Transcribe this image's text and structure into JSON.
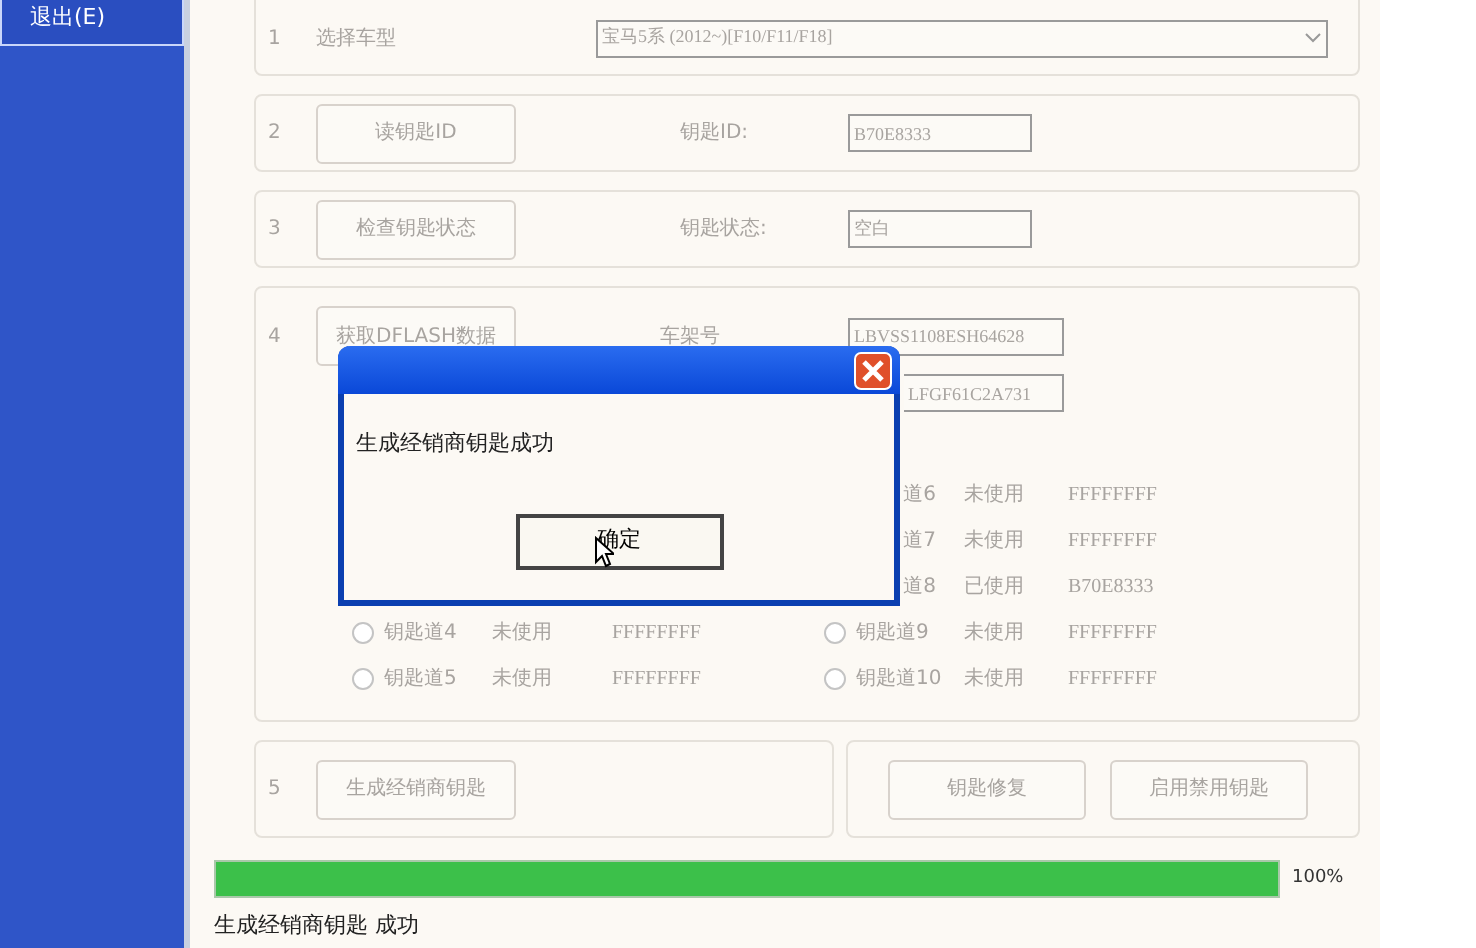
{
  "sidebar": {
    "items": [
      {
        "label": "退出(E)",
        "selected": true
      }
    ]
  },
  "steps": [
    {
      "kind": "select",
      "number": "1",
      "label": "选择车型",
      "value": "宝马5系 (2012~)[F10/F11/F18]"
    },
    {
      "kind": "read",
      "number": "2",
      "button": "读钥匙ID",
      "label": "钥匙ID:",
      "value": "B70E8333"
    },
    {
      "kind": "read",
      "number": "3",
      "button": "检查钥匙状态",
      "label": "钥匙状态:",
      "value": "空白"
    },
    {
      "kind": "keys",
      "number": "4",
      "button": "获取DFLASH数据",
      "label": "车架号",
      "value": "LBVSS1108ESH64628",
      "value_2": "LFGF61C2A731",
      "key_rows": [
        {
          "right": {
            "kind": "partial",
            "label": "道6",
            "status": "未使用",
            "code": "FFFFFFFF"
          }
        },
        {
          "right": {
            "kind": "partial",
            "label": "道7",
            "status": "未使用",
            "code": "FFFFFFFF"
          }
        },
        {
          "right": {
            "kind": "partial",
            "label": "道8",
            "status": "已使用",
            "code": "B70E8333"
          }
        },
        {
          "left": {
            "kind": "full",
            "selected": false,
            "label": "钥匙道4",
            "status": "未使用",
            "code": "FFFFFFFF"
          },
          "right": {
            "kind": "full",
            "selected": false,
            "label": "钥匙道9",
            "status": "未使用",
            "code": "FFFFFFFF"
          }
        },
        {
          "left": {
            "kind": "full",
            "selected": false,
            "label": "钥匙道5",
            "status": "未使用",
            "code": "FFFFFFFF"
          },
          "right": {
            "kind": "full",
            "selected": false,
            "label": "钥匙道10",
            "status": "未使用",
            "code": "FFFFFFFF"
          }
        }
      ]
    },
    {
      "kind": "actions",
      "number": "5",
      "button": "生成经销商钥匙",
      "buttons": [
        "钥匙修复",
        "启用禁用钥匙"
      ]
    }
  ],
  "progress": {
    "level": 1.0,
    "reading": "100%"
  },
  "status_bar": "生成经销商钥匙 成功",
  "dialog": {
    "message": "生成经销商钥匙成功",
    "button": "确定"
  }
}
